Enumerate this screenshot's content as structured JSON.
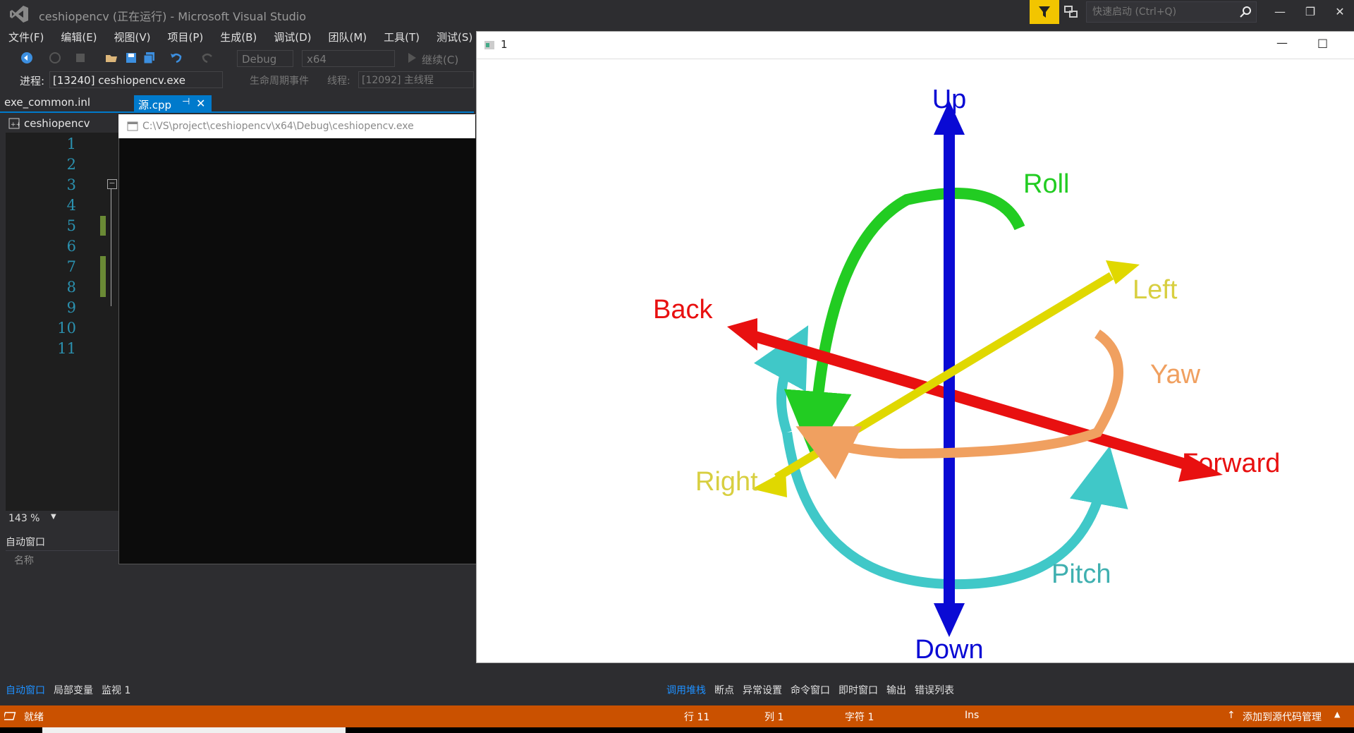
{
  "app": {
    "title": "ceshiopencv (正在运行) - Microsoft Visual Studio",
    "quick_launch_placeholder": "快速启动 (Ctrl+Q)"
  },
  "menu": [
    "文件(F)",
    "编辑(E)",
    "视图(V)",
    "项目(P)",
    "生成(B)",
    "调试(D)",
    "团队(M)",
    "工具(T)",
    "测试(S)"
  ],
  "toolbar": {
    "config": "Debug",
    "platform": "x64",
    "continue_label": "继续(C)"
  },
  "process_bar": {
    "process_label": "进程:",
    "process_value": "[13240] ceshiopencv.exe",
    "lifecycle_label": "生命周期事件",
    "thread_label": "线程:",
    "thread_value": "[12092] 主线程"
  },
  "tabs": {
    "inactive": "exe_common.inl",
    "active": "源.cpp"
  },
  "editor": {
    "nav_project": "ceshiopencv",
    "line_numbers": [
      "1",
      "2",
      "3",
      "4",
      "5",
      "6",
      "7",
      "8",
      "9",
      "10",
      "11"
    ],
    "zoom": "143 %"
  },
  "console": {
    "title": "C:\\VS\\project\\ceshiopencv\\x64\\Debug\\ceshiopencv.exe"
  },
  "auto_window": {
    "title": "自动窗口",
    "column_name": "名称"
  },
  "image_window": {
    "title": "1",
    "labels": {
      "up": "Up",
      "down": "Down",
      "roll": "Roll",
      "left": "Left",
      "back": "Back",
      "yaw": "Yaw",
      "forward": "Forward",
      "right": "Right",
      "pitch": "Pitch"
    },
    "colors": {
      "up_down": "#0a0ad4",
      "roll": "#22cc22",
      "left_right": "#e0d800",
      "back_forward": "#e81010",
      "yaw": "#f0a060",
      "pitch": "#40c8c8"
    }
  },
  "bottom_tabs_left": [
    "自动窗口",
    "局部变量",
    "监视 1"
  ],
  "bottom_tabs_right": [
    "调用堆栈",
    "断点",
    "异常设置",
    "命令窗口",
    "即时窗口",
    "输出",
    "错误列表"
  ],
  "status": {
    "ready": "就绪",
    "line": "行 11",
    "col": "列 1",
    "char": "字符 1",
    "ins": "Ins",
    "source_control": "添加到源代码管理"
  }
}
